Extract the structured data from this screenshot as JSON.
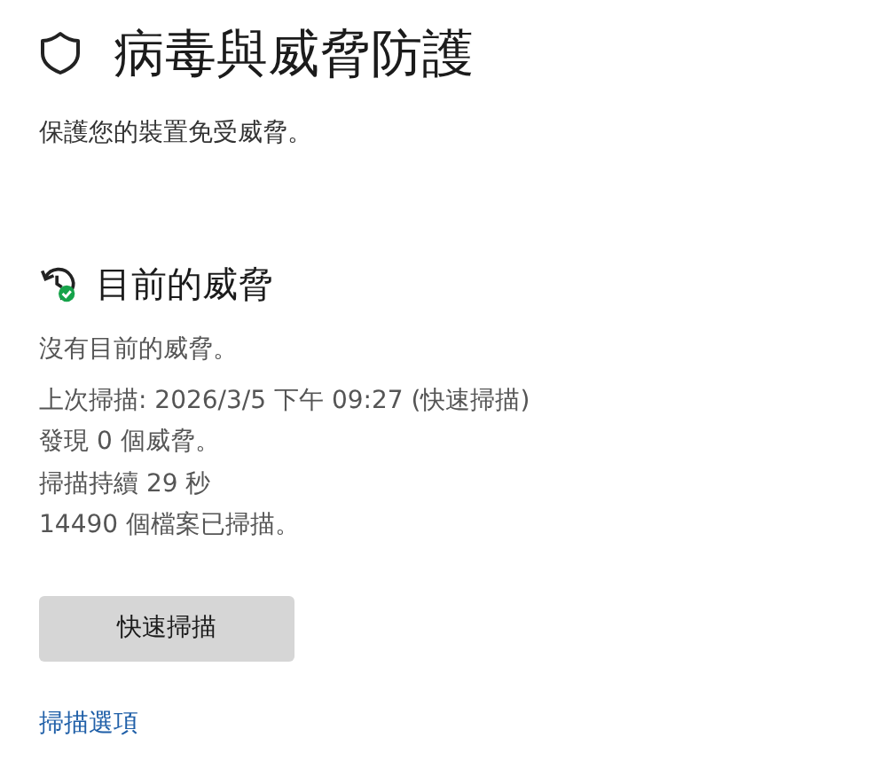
{
  "page": {
    "title": "病毒與威脅防護",
    "subtitle": "保護您的裝置免受威脅。"
  },
  "current_threats": {
    "heading": "目前的威脅",
    "lines": [
      "沒有目前的威脅。",
      "上次掃描: 2026/3/5 下午 09:27 (快速掃描)",
      "發現 0 個威脅。",
      "掃描持續 29 秒",
      "14490 個檔案已掃描。"
    ],
    "button": "快速掃描",
    "link": "掃描選項"
  }
}
